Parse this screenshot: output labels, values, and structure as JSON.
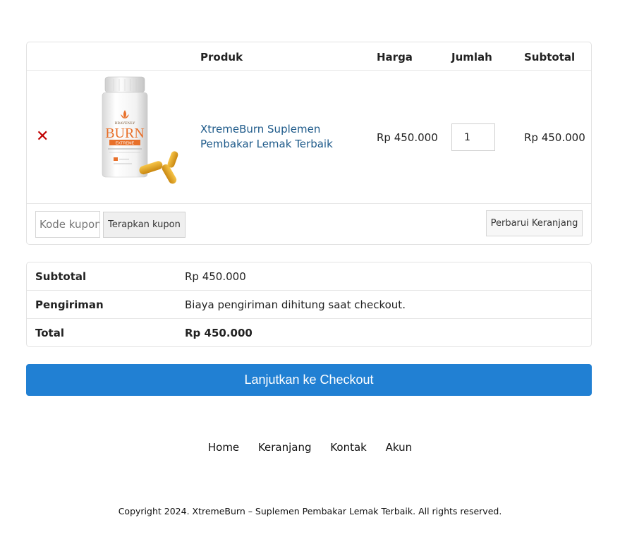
{
  "cart": {
    "headers": {
      "product": "Produk",
      "price": "Harga",
      "quantity": "Jumlah",
      "subtotal": "Subtotal"
    },
    "items": [
      {
        "remove_symbol": "✕",
        "image_icon": "supplement-bottle-image",
        "brand_small": "BRAVENLY",
        "brand_big": "BURN",
        "brand_band": "EXTREME",
        "name": "XtremeBurn Suplemen Pembakar Lemak Terbaik",
        "price": "Rp 450.000",
        "quantity": "1",
        "subtotal": "Rp 450.000"
      }
    ],
    "coupon_placeholder": "Kode kupon",
    "apply_coupon_label": "Terapkan kupon",
    "update_cart_label": "Perbarui Keranjang"
  },
  "totals": {
    "subtotal_label": "Subtotal",
    "subtotal_value": "Rp 450.000",
    "shipping_label": "Pengiriman",
    "shipping_value": "Biaya pengiriman dihitung saat checkout.",
    "total_label": "Total",
    "total_value": "Rp 450.000"
  },
  "checkout_label": "Lanjutkan ke Checkout",
  "footer": {
    "nav": [
      "Home",
      "Keranjang",
      "Kontak",
      "Akun"
    ],
    "copyright": "Copyright 2024. XtremeBurn – Suplemen Pembakar Lemak Terbaik. All rights reserved."
  },
  "colors": {
    "accent": "#2180d3",
    "link": "#1e5a8a",
    "remove": "#c00000",
    "label_orange": "#e8702a"
  }
}
